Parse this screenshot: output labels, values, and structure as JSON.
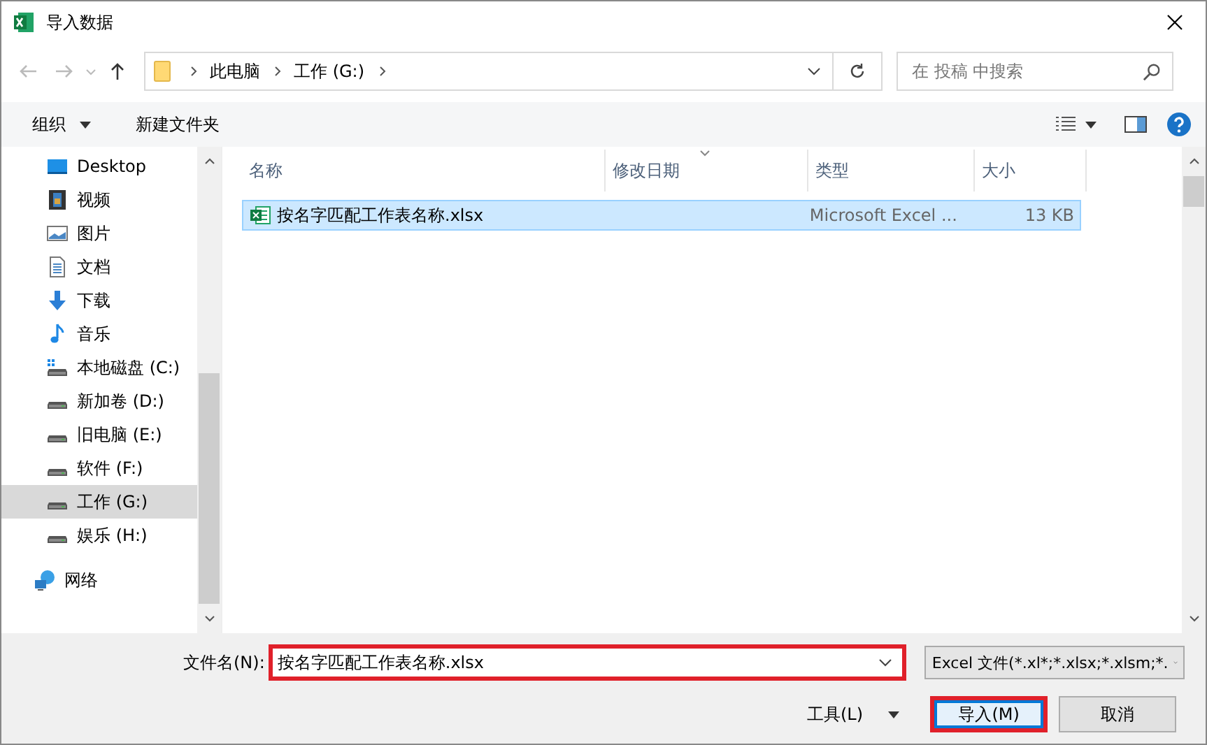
{
  "window": {
    "title": "导入数据"
  },
  "address": {
    "crumbs": [
      "此电脑",
      "工作 (G:)"
    ]
  },
  "search": {
    "placeholder": "在 投稿 中搜索"
  },
  "toolbar": {
    "organize": "组织",
    "new_folder": "新建文件夹"
  },
  "sidebar": {
    "items": [
      {
        "label": "Desktop",
        "kind": "desktop",
        "selected": false
      },
      {
        "label": "视频",
        "kind": "video",
        "selected": false
      },
      {
        "label": "图片",
        "kind": "pictures",
        "selected": false
      },
      {
        "label": "文档",
        "kind": "documents",
        "selected": false
      },
      {
        "label": "下载",
        "kind": "download",
        "selected": false
      },
      {
        "label": "音乐",
        "kind": "music",
        "selected": false
      },
      {
        "label": "本地磁盘 (C:)",
        "kind": "system-drive",
        "selected": false
      },
      {
        "label": "新加卷 (D:)",
        "kind": "drive",
        "selected": false
      },
      {
        "label": "旧电脑 (E:)",
        "kind": "drive",
        "selected": false
      },
      {
        "label": "软件 (F:)",
        "kind": "drive",
        "selected": false
      },
      {
        "label": "工作 (G:)",
        "kind": "drive",
        "selected": true
      },
      {
        "label": "娱乐 (H:)",
        "kind": "drive",
        "selected": false
      },
      {
        "label": "网络",
        "kind": "network",
        "selected": false
      }
    ]
  },
  "table": {
    "columns": [
      "名称",
      "修改日期",
      "类型",
      "大小"
    ],
    "rows": [
      {
        "name": "按名字匹配工作表名称.xlsx",
        "type": "Microsoft Excel ...",
        "size": "13 KB",
        "selected": true
      }
    ]
  },
  "footer": {
    "filename_label": "文件名(N):",
    "filename": "按名字匹配工作表名称.xlsx",
    "filename_highlighted": true,
    "filetype": "Excel 文件(*.xl*;*.xlsx;*.xlsm;*.",
    "tools": "工具(L)",
    "buttons": [
      {
        "label": "导入(M)",
        "kind": "primary",
        "highlighted": true
      },
      {
        "label": "取消",
        "kind": "cancel",
        "highlighted": false
      }
    ]
  }
}
